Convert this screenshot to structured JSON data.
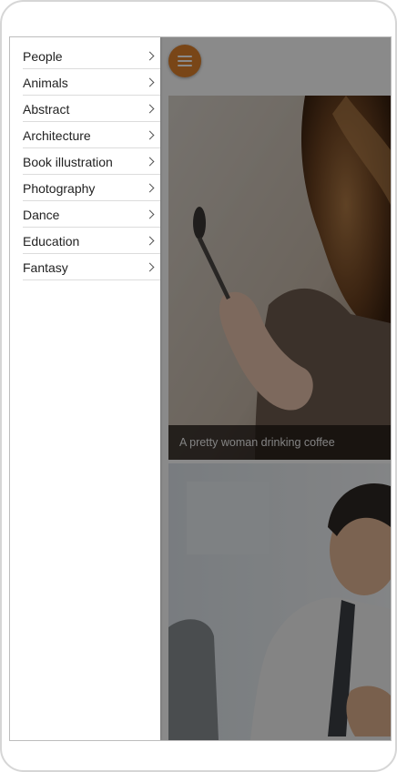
{
  "drawer": {
    "items": [
      {
        "label": "People"
      },
      {
        "label": "Animals"
      },
      {
        "label": "Abstract"
      },
      {
        "label": "Architecture"
      },
      {
        "label": "Book illustration"
      },
      {
        "label": "Photography"
      },
      {
        "label": "Dance"
      },
      {
        "label": "Education"
      },
      {
        "label": "Fantasy"
      }
    ],
    "chevron_icon": "chevron-right-icon"
  },
  "header": {
    "menu_icon": "hamburger-menu-icon",
    "menu_button_color": "#e0812b"
  },
  "cards": [
    {
      "caption": "A pretty woman drinking coffee"
    },
    {
      "caption": ""
    }
  ]
}
